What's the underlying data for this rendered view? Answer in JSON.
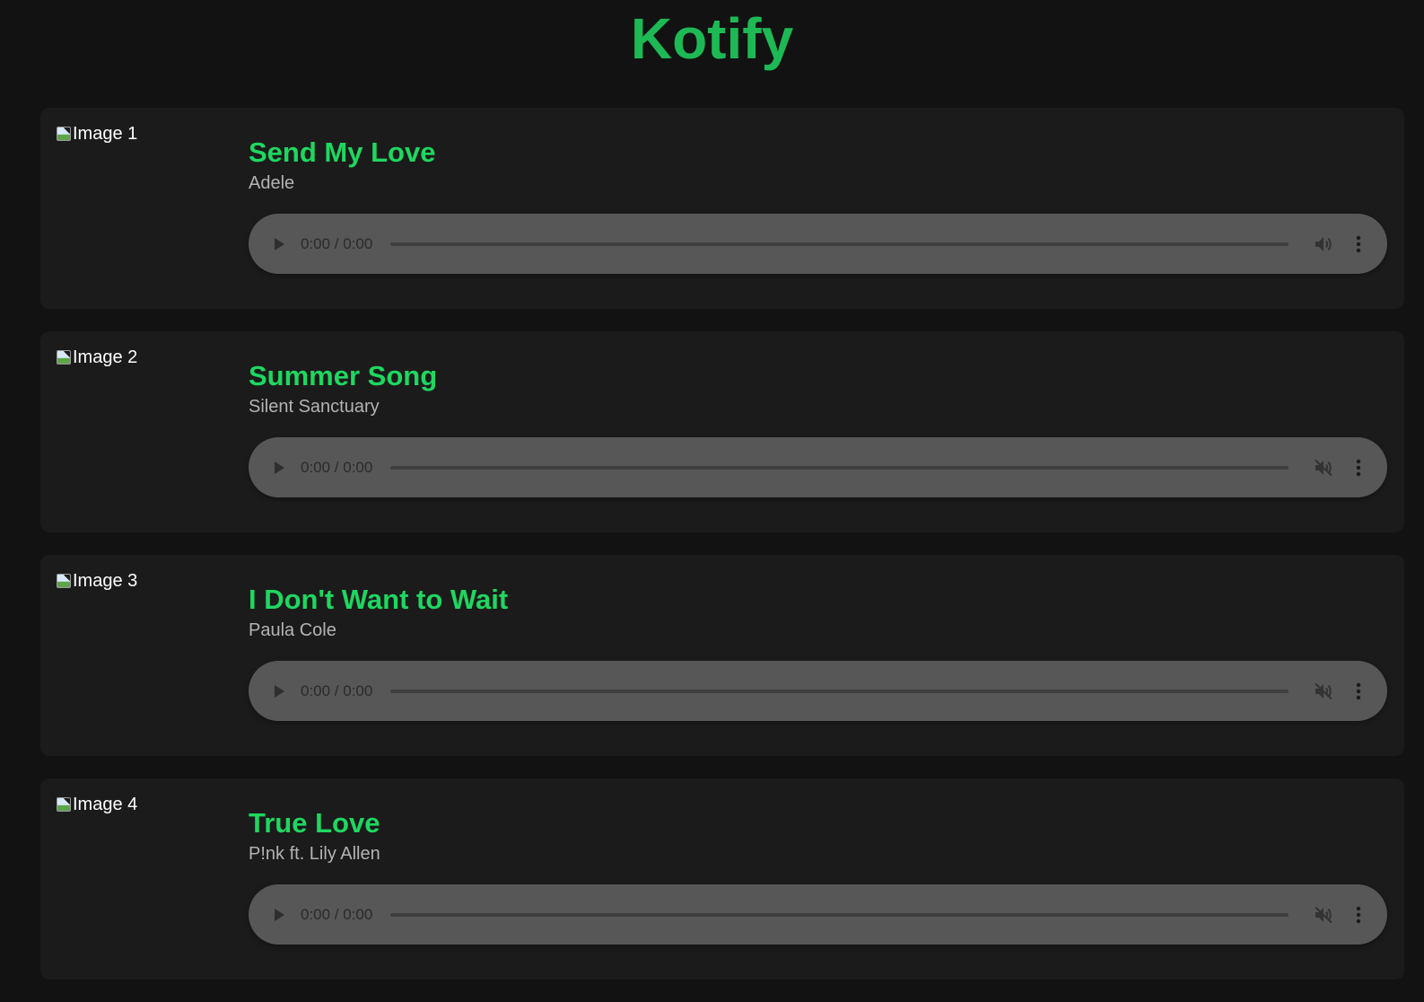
{
  "app": {
    "title": "Kotify"
  },
  "tracks": [
    {
      "image_alt": "Image 1",
      "title": "Send My Love",
      "artist": "Adele",
      "player": {
        "time": "0:00 / 0:00",
        "muted": false
      }
    },
    {
      "image_alt": "Image 2",
      "title": "Summer Song",
      "artist": "Silent Sanctuary",
      "player": {
        "time": "0:00 / 0:00",
        "muted": true
      }
    },
    {
      "image_alt": "Image 3",
      "title": "I Don't Want to Wait",
      "artist": "Paula Cole",
      "player": {
        "time": "0:00 / 0:00",
        "muted": true
      }
    },
    {
      "image_alt": "Image 4",
      "title": "True Love",
      "artist": "P!nk ft. Lily Allen",
      "player": {
        "time": "0:00 / 0:00",
        "muted": true
      }
    }
  ],
  "icons": {
    "play": "play-icon",
    "volume": "volume-icon",
    "muted": "volume-muted-icon",
    "more": "more-options-icon",
    "broken_image": "broken-image-icon"
  },
  "colors": {
    "background": "#121212",
    "card": "#1b1b1b",
    "accent": "#1db954",
    "track_title": "#1ed760",
    "artist": "#b3b3b3",
    "player": "#575757"
  }
}
